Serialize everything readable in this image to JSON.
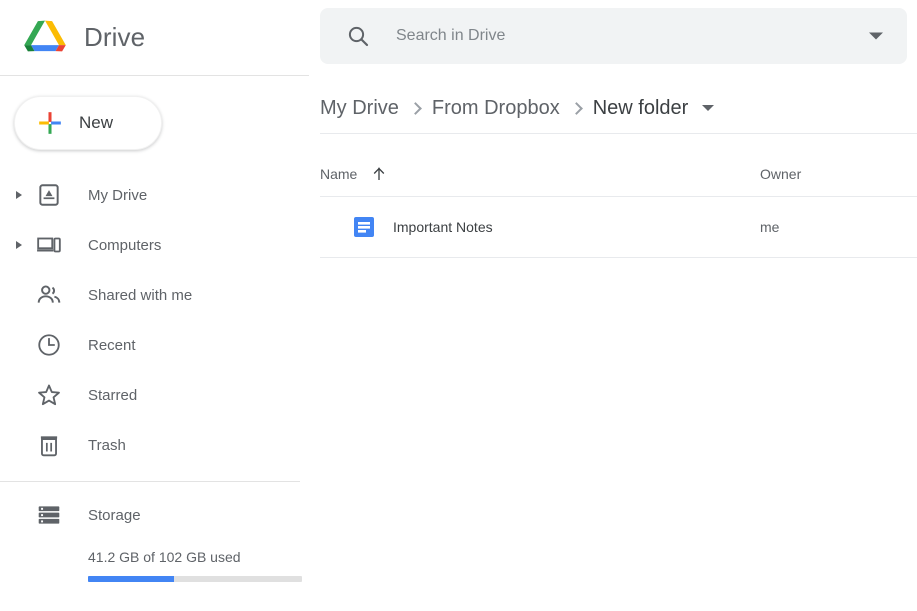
{
  "brand": {
    "name": "Drive",
    "logo_icon": "google-drive-logo",
    "colors": {
      "green": "#34a853",
      "yellow": "#fbbc04",
      "blue": "#4285f4",
      "red": "#ea4335",
      "blue_dark": "#1967d2"
    }
  },
  "new_button": {
    "label": "New",
    "icon": "plus-icon"
  },
  "sidebar": {
    "items": [
      {
        "label": "My Drive",
        "icon": "my-drive-icon",
        "expandable": true
      },
      {
        "label": "Computers",
        "icon": "computers-icon",
        "expandable": true
      },
      {
        "label": "Shared with me",
        "icon": "people-icon",
        "expandable": false
      },
      {
        "label": "Recent",
        "icon": "clock-icon",
        "expandable": false
      },
      {
        "label": "Starred",
        "icon": "star-icon",
        "expandable": false
      },
      {
        "label": "Trash",
        "icon": "trash-icon",
        "expandable": false
      }
    ],
    "storage": {
      "label": "Storage",
      "icon": "storage-icon",
      "usage_text": "41.2 GB of 102 GB used",
      "used_gb": 41.2,
      "total_gb": 102,
      "percent": 40,
      "fill_color": "#4285f4",
      "track_color": "#e0e0e0"
    }
  },
  "search": {
    "placeholder": "Search in Drive",
    "icon": "search-icon",
    "options_icon": "chevron-down-icon"
  },
  "breadcrumb": {
    "items": [
      "My Drive",
      "From Dropbox",
      "New folder"
    ],
    "menu_icon": "chevron-down-icon"
  },
  "table": {
    "columns": {
      "name": "Name",
      "owner": "Owner"
    },
    "sort": {
      "column": "Name",
      "direction": "asc",
      "icon": "arrow-up-icon"
    },
    "rows": [
      {
        "name": "Important Notes",
        "owner": "me",
        "icon": "google-docs-icon",
        "icon_color": "#4285f4"
      }
    ]
  }
}
